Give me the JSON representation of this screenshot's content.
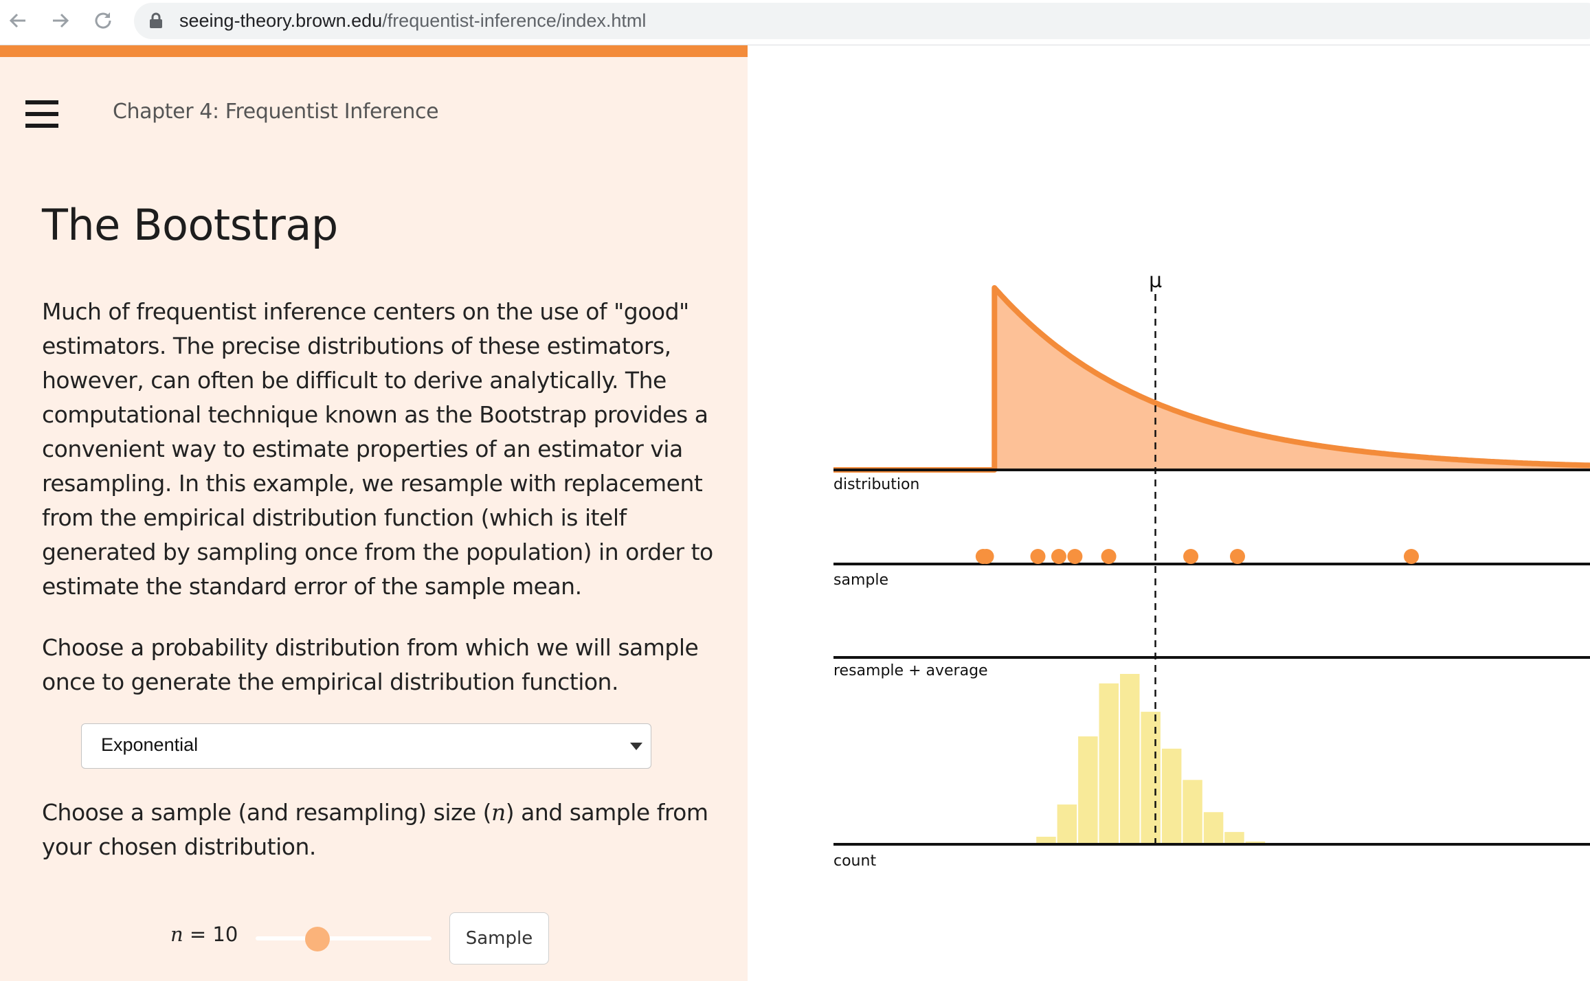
{
  "browser": {
    "url_host": "seeing-theory.brown.edu",
    "url_path": "/frequentist-inference/index.html"
  },
  "header": {
    "chapter": "Chapter 4: Frequentist Inference"
  },
  "main": {
    "title": "The Bootstrap",
    "paragraph_1": "Much of frequentist inference centers on the use of \"good\" estimators. The precise distributions of these estimators, however, can often be difficult to derive analytically. The computational technique known as the Bootstrap provides a convenient way to estimate properties of an estimator via resampling. In this example, we resample with replacement from the empirical distribution function (which is itelf generated by sampling once from the population) in order to estimate the standard error of the sample mean.",
    "paragraph_2": "Choose a probability distribution from which we will sample once to generate the empirical distribution function.",
    "paragraph_3_before": "Choose a sample (and resampling) size (",
    "paragraph_3_var": "n",
    "paragraph_3_after": ") and sample from your chosen distribution."
  },
  "controls": {
    "distribution_selected": "Exponential",
    "n_var": "n",
    "n_eq": " = 10",
    "n_value": 10,
    "n_slider_fraction": 0.35,
    "sample_button": "Sample"
  },
  "icons": {
    "back": "back-arrow-icon",
    "forward": "forward-arrow-icon",
    "reload": "reload-icon",
    "lock": "lock-icon",
    "menu": "hamburger-menu-icon"
  },
  "colors": {
    "accent": "#f38b3a",
    "panel_bg": "#fef0e7",
    "density_fill": "#fdc197",
    "sample_point": "#f7913e",
    "histogram_bar": "#f8ea99"
  },
  "chart_data": {
    "type": "composite",
    "mu_label": "μ",
    "mu": 1,
    "distribution": {
      "label": "distribution",
      "name": "Exponential",
      "x_range": [
        -1,
        3.7
      ],
      "support_start": 0,
      "rate": 1
    },
    "sample": {
      "label": "sample",
      "values": [
        -0.07,
        -0.05,
        0.27,
        0.4,
        0.5,
        0.71,
        1.22,
        1.51,
        2.59
      ]
    },
    "resample_average": {
      "label": "resample + average"
    },
    "count": {
      "label": "count",
      "bin_start": 0.13,
      "bin_width": 0.13,
      "counts": [
        1,
        8,
        42,
        114,
        170,
        180,
        140,
        101,
        68,
        34,
        13,
        3,
        1
      ]
    }
  }
}
